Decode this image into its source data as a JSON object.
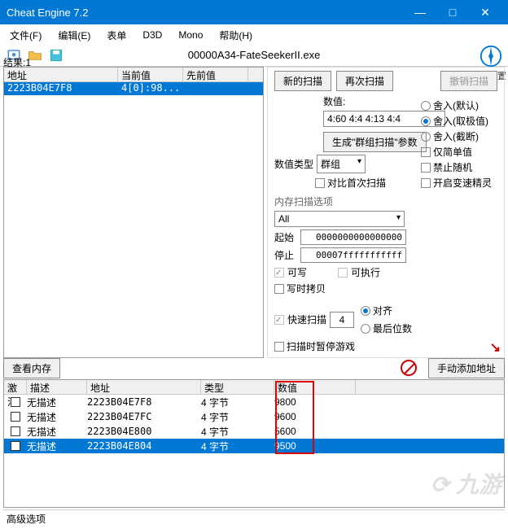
{
  "window": {
    "title": "Cheat Engine 7.2"
  },
  "menu": [
    "文件(F)",
    "编辑(E)",
    "表单",
    "D3D",
    "Mono",
    "帮助(H)"
  ],
  "process": "00000A34-FateSeekerII.exe",
  "settings_label": "设置",
  "results": {
    "label": "结果:1",
    "headers": {
      "addr": "地址",
      "current": "当前值",
      "prev": "先前值"
    },
    "rows": [
      {
        "addr": "2223B04E7F8",
        "current": "4[0]:98...",
        "prev": ""
      }
    ]
  },
  "scan": {
    "new_scan": "新的扫描",
    "rescan": "再次扫描",
    "undo_scan": "撤销扫描",
    "value_label": "数值:",
    "value": "4:60 4:4 4:13 4:4",
    "gen_group": "生成\"群组扫描\"参数",
    "value_type_label": "数值类型",
    "value_type": "群组",
    "compare_first": "对比首次扫描",
    "memopts_label": "内存扫描选项",
    "memopts": "All",
    "start_label": "起始",
    "start": "0000000000000000",
    "stop_label": "停止",
    "stop": "00007fffffffffff",
    "writable": "可写",
    "executable": "可执行",
    "copy_on_write": "写时拷贝",
    "fast_scan": "快速扫描",
    "fast_scan_val": "4",
    "align": "对齐",
    "last_digits": "最后位数",
    "pause_game": "扫描时暂停游戏",
    "options_right": {
      "round_default": "舍入(默认)",
      "round_extreme": "舍入(取极值)",
      "round_trunc": "舍入(截断)",
      "simple_only": "仅简单值",
      "no_random": "禁止随机",
      "speedhack": "开启变速精灵"
    }
  },
  "midbar": {
    "view_mem": "查看内存",
    "add_manual": "手动添加地址"
  },
  "cheat": {
    "headers": {
      "active": "激活",
      "desc": "描述",
      "addr": "地址",
      "type": "类型",
      "value": "数值"
    },
    "rows": [
      {
        "desc": "无描述",
        "addr": "2223B04E7F8",
        "type": "4 字节",
        "value": "9800",
        "selected": false
      },
      {
        "desc": "无描述",
        "addr": "2223B04E7FC",
        "type": "4 字节",
        "value": "9600",
        "selected": false
      },
      {
        "desc": "无描述",
        "addr": "2223B04E800",
        "type": "4 字节",
        "value": "5600",
        "selected": false
      },
      {
        "desc": "无描述",
        "addr": "2223B04E804",
        "type": "4 字节",
        "value": "9500",
        "selected": true
      }
    ]
  },
  "status": "高级选项",
  "watermark": "九游"
}
